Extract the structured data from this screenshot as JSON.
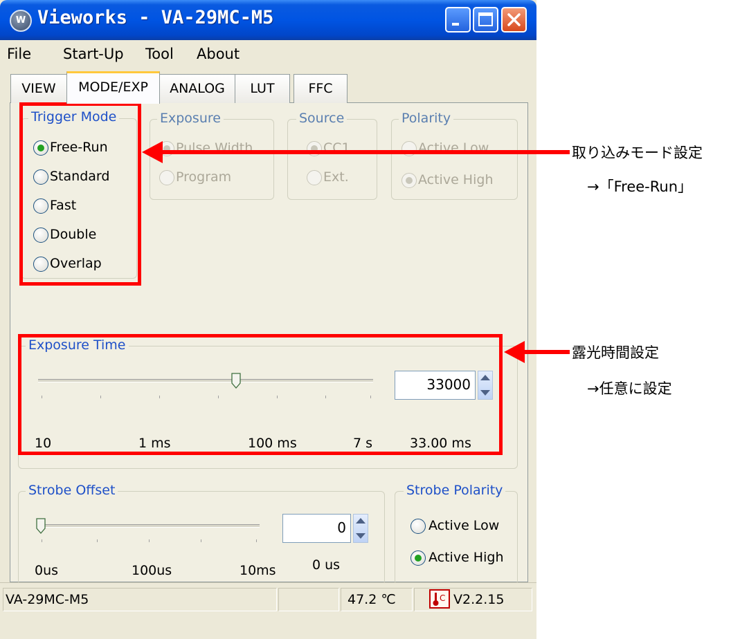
{
  "window": {
    "title": "Vieworks - VA-29MC-M5",
    "app_icon_glyph": "W"
  },
  "menu": [
    "File",
    "Start-Up",
    "Tool",
    "About"
  ],
  "tabs": [
    {
      "label": "VIEW"
    },
    {
      "label": "MODE/EXP",
      "active": true
    },
    {
      "label": "ANALOG"
    },
    {
      "label": "LUT"
    },
    {
      "label": "FFC"
    }
  ],
  "trigger_mode": {
    "title": "Trigger Mode",
    "options": [
      "Free-Run",
      "Standard",
      "Fast",
      "Double",
      "Overlap"
    ],
    "selected": "Free-Run"
  },
  "exposure": {
    "title": "Exposure",
    "options": [
      "Pulse Width",
      "Program"
    ],
    "selected": "Pulse Width",
    "enabled": false
  },
  "source": {
    "title": "Source",
    "options": [
      "CC1",
      "Ext."
    ],
    "selected": "CC1",
    "enabled": false
  },
  "polarity": {
    "title": "Polarity",
    "options": [
      "Active Low",
      "Active High"
    ],
    "selected": "Active High",
    "enabled": false
  },
  "exposure_time": {
    "title": "Exposure Time",
    "value": "33000",
    "display": "33.00 ms",
    "scale": [
      "10",
      "1 ms",
      "100 ms",
      "7 s"
    ],
    "slider_fraction": 0.59
  },
  "strobe_offset": {
    "title": "Strobe Offset",
    "value": "0",
    "display": "0 us",
    "scale": [
      "0us",
      "100us",
      "10ms"
    ],
    "slider_fraction": 0.0
  },
  "strobe_polarity": {
    "title": "Strobe Polarity",
    "options": [
      "Active Low",
      "Active High"
    ],
    "selected": "Active High"
  },
  "status": {
    "model": "VA-29MC-M5",
    "temperature": "47.2 ℃",
    "version": "V2.2.15",
    "temp_icon": "thermometer-icon"
  },
  "annotations": {
    "trigger_note_1": "取り込みモード設定",
    "trigger_note_2": "→「Free-Run」",
    "exposure_note_1": "露光時間設定",
    "exposure_note_2": "→任意に設定",
    "highlight_color": "#ff0000"
  },
  "colors": {
    "titlebar": "#0054e3",
    "window_bg": "#ece9d8",
    "group_label": "#1e50c8",
    "radio_selected": "#21a121"
  }
}
